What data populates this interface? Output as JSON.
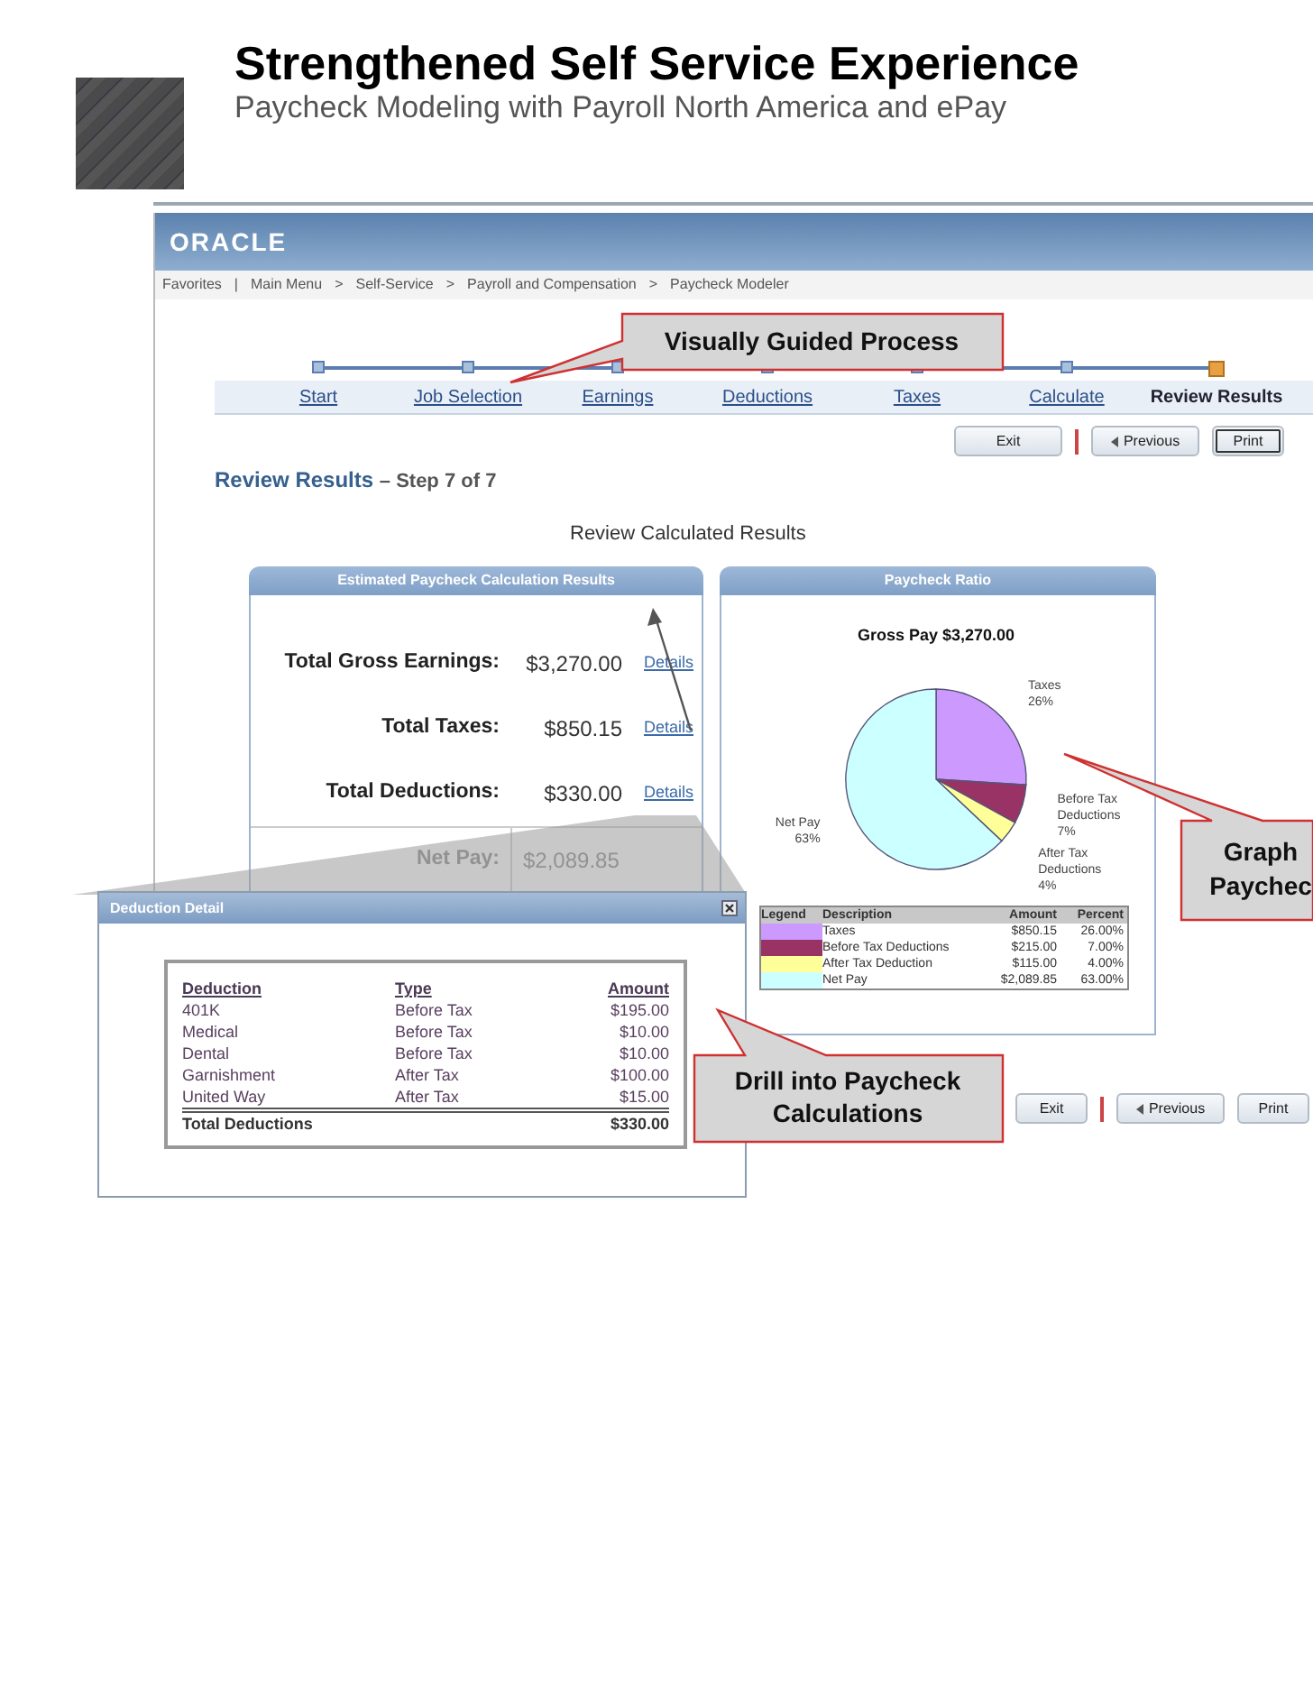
{
  "slide": {
    "title": "Strengthened Self Service Experience",
    "subtitle": "Paycheck Modeling with Payroll North America and ePay"
  },
  "app": {
    "logo": "ORACLE",
    "breadcrumb": [
      "Favorites",
      "|",
      "Main Menu",
      ">",
      "Self-Service",
      ">",
      "Payroll and Compensation",
      ">",
      "Paycheck Modeler"
    ],
    "steps": [
      {
        "label": "Start",
        "selected": false
      },
      {
        "label": "Job Selection",
        "selected": false
      },
      {
        "label": "Earnings",
        "selected": false
      },
      {
        "label": "Deductions",
        "selected": false
      },
      {
        "label": "Taxes",
        "selected": false
      },
      {
        "label": "Calculate",
        "selected": false
      },
      {
        "label": "Review Results",
        "selected": true
      }
    ],
    "top_buttons": [
      {
        "label": "Exit",
        "kind": "plain",
        "divider_after": true,
        "focused": false
      },
      {
        "label": "Previous",
        "kind": "back",
        "divider_after": false,
        "focused": false
      },
      {
        "label": "Print",
        "kind": "plain",
        "divider_after": false,
        "focused": true
      }
    ],
    "page_heading": "Review Results",
    "page_step": "– Step 7 of 7",
    "section_title": "Review Calculated Results",
    "results_panel": {
      "title": "Estimated Paycheck Calculation Results",
      "rows": [
        {
          "label": "Total Gross Earnings:",
          "value": "$3,270.00",
          "link": "Details",
          "kind": "line"
        },
        {
          "label": "Total Taxes:",
          "value": "$850.15",
          "link": "Details",
          "kind": "line"
        },
        {
          "label": "Total Deductions:",
          "value": "$330.00",
          "link": "Details",
          "kind": "line"
        },
        {
          "label": "Net Pay:",
          "value": "$2,089.85",
          "kind": "total"
        }
      ]
    },
    "ratio_panel": {
      "title": "Paycheck Ratio",
      "chart_data": {
        "type": "pie",
        "title": "Gross Pay $3,270.00",
        "categories": [
          "Taxes",
          "Before Tax Deductions",
          "After Tax Deductions",
          "Net Pay"
        ],
        "values": [
          26,
          7,
          4,
          63
        ],
        "value_labels": [
          "26%",
          "7%",
          "4%",
          "63%"
        ]
      },
      "legend": {
        "columns": [
          "Legend",
          "Description",
          "Amount",
          "Percent"
        ],
        "rows": [
          {
            "color": "#cc99ff",
            "description": "Taxes",
            "amount": "$850.15",
            "percent": "26.00%"
          },
          {
            "color": "#993366",
            "description": "Before Tax Deductions",
            "amount": "$215.00",
            "percent": "7.00%"
          },
          {
            "color": "#ffff99",
            "description": "After Tax Deduction",
            "amount": "$115.00",
            "percent": "4.00%"
          },
          {
            "color": "#ccffff",
            "description": "Net Pay",
            "amount": "$2,089.85",
            "percent": "63.00%"
          }
        ]
      }
    },
    "bottom_buttons": [
      {
        "label": "Exit",
        "kind": "plain",
        "divider_after": true,
        "focused": false
      },
      {
        "label": "Previous",
        "kind": "back",
        "divider_after": false,
        "focused": false
      },
      {
        "label": "Print",
        "kind": "plain",
        "divider_after": false,
        "focused": false
      }
    ]
  },
  "popup": {
    "title": "Deduction Detail",
    "columns": [
      "Deduction",
      "Type",
      "Amount"
    ],
    "rows": [
      [
        "401K",
        "Before Tax",
        "$195.00"
      ],
      [
        "Medical",
        "Before Tax",
        "$10.00"
      ],
      [
        "Dental",
        "Before Tax",
        "$10.00"
      ],
      [
        "Garnishment",
        "After Tax",
        "$100.00"
      ],
      [
        "United Way",
        "After Tax",
        "$15.00"
      ]
    ],
    "total": {
      "label": "Total Deductions",
      "amount": "$330.00"
    }
  },
  "callouts": [
    {
      "lines": [
        "Visually Guided Process"
      ]
    },
    {
      "lines": [
        "Drill into Paycheck",
        "Calculations"
      ]
    },
    {
      "lines": [
        "Graph",
        "Paychec"
      ]
    }
  ]
}
